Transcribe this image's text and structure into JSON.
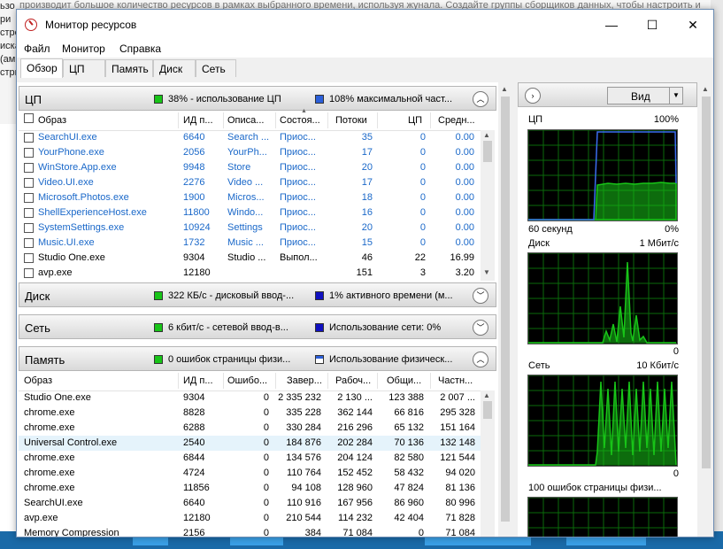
{
  "background": {
    "left_lines": [
      "ьзо",
      "ри",
      "строй",
      "иска",
      "(ам",
      "стри"
    ],
    "top_text": "производит большое количество ресурсов в рамках выбранного времени, используя жунала. Создайте группы сборщиков данных, чтобы настроить и запланировать"
  },
  "window": {
    "title": "Монитор ресурсов",
    "controls": {
      "minimize": "—",
      "maximize": "☐",
      "close": "✕"
    }
  },
  "menu": [
    "Файл",
    "Монитор",
    "Справка"
  ],
  "tabs": [
    "Обзор",
    "ЦП",
    "Память",
    "Диск",
    "Сеть"
  ],
  "cpu": {
    "title": "ЦП",
    "usage_text": "38% - использование ЦП",
    "max_text": "108% максимальной част...",
    "columns": [
      "Образ",
      "ИД п...",
      "Описа...",
      "Состоя...",
      "Потоки",
      "ЦП",
      "Средн..."
    ],
    "rows": [
      {
        "image": "SearchUI.exe",
        "pid": "6640",
        "desc": "Search ...",
        "status": "Приос...",
        "threads": "35",
        "cpu": "0",
        "avg": "0.00",
        "suspended": true
      },
      {
        "image": "YourPhone.exe",
        "pid": "2056",
        "desc": "YourPh...",
        "status": "Приос...",
        "threads": "17",
        "cpu": "0",
        "avg": "0.00",
        "suspended": true
      },
      {
        "image": "WinStore.App.exe",
        "pid": "9948",
        "desc": "Store",
        "status": "Приос...",
        "threads": "20",
        "cpu": "0",
        "avg": "0.00",
        "suspended": true
      },
      {
        "image": "Video.UI.exe",
        "pid": "2276",
        "desc": "Video ...",
        "status": "Приос...",
        "threads": "17",
        "cpu": "0",
        "avg": "0.00",
        "suspended": true
      },
      {
        "image": "Microsoft.Photos.exe",
        "pid": "1900",
        "desc": "Micros...",
        "status": "Приос...",
        "threads": "18",
        "cpu": "0",
        "avg": "0.00",
        "suspended": true
      },
      {
        "image": "ShellExperienceHost.exe",
        "pid": "11800",
        "desc": "Windo...",
        "status": "Приос...",
        "threads": "16",
        "cpu": "0",
        "avg": "0.00",
        "suspended": true
      },
      {
        "image": "SystemSettings.exe",
        "pid": "10924",
        "desc": "Settings",
        "status": "Приос...",
        "threads": "20",
        "cpu": "0",
        "avg": "0.00",
        "suspended": true
      },
      {
        "image": "Music.UI.exe",
        "pid": "1732",
        "desc": "Music ...",
        "status": "Приос...",
        "threads": "15",
        "cpu": "0",
        "avg": "0.00",
        "suspended": true
      },
      {
        "image": "Studio One.exe",
        "pid": "9304",
        "desc": "Studio ...",
        "status": "Выпол...",
        "threads": "46",
        "cpu": "22",
        "avg": "16.99",
        "suspended": false
      },
      {
        "image": "avp.exe",
        "pid": "12180",
        "desc": "",
        "status": "",
        "threads": "151",
        "cpu": "3",
        "avg": "3.20",
        "suspended": false
      }
    ]
  },
  "disk": {
    "title": "Диск",
    "io_text": "322 КБ/с - дисковый ввод-...",
    "active_text": "1% активного времени (м..."
  },
  "network": {
    "title": "Сеть",
    "io_text": "6 кбит/с - сетевой ввод-в...",
    "usage_text": "Использование сети: 0%"
  },
  "memory": {
    "title": "Память",
    "faults_text": "0 ошибок страницы физи...",
    "usage_text": "Использование физическ...",
    "columns": [
      "Образ",
      "ИД п...",
      "Ошибо...",
      "Завер...",
      "Рабоч...",
      "Общи...",
      "Частн..."
    ],
    "rows": [
      {
        "image": "Studio One.exe",
        "pid": "9304",
        "faults": "0",
        "commit": "2 335 232",
        "working": "2 130 ...",
        "shared": "123 388",
        "private": "2 007 ..."
      },
      {
        "image": "chrome.exe",
        "pid": "8828",
        "faults": "0",
        "commit": "335 228",
        "working": "362 144",
        "shared": "66 816",
        "private": "295 328"
      },
      {
        "image": "chrome.exe",
        "pid": "6288",
        "faults": "0",
        "commit": "330 284",
        "working": "216 296",
        "shared": "65 132",
        "private": "151 164"
      },
      {
        "image": "Universal Control.exe",
        "pid": "2540",
        "faults": "0",
        "commit": "184 876",
        "working": "202 284",
        "shared": "70 136",
        "private": "132 148"
      },
      {
        "image": "chrome.exe",
        "pid": "6844",
        "faults": "0",
        "commit": "134 576",
        "working": "204 124",
        "shared": "82 580",
        "private": "121 544"
      },
      {
        "image": "chrome.exe",
        "pid": "4724",
        "faults": "0",
        "commit": "110 764",
        "working": "152 452",
        "shared": "58 432",
        "private": "94 020"
      },
      {
        "image": "chrome.exe",
        "pid": "11856",
        "faults": "0",
        "commit": "94 108",
        "working": "128 960",
        "shared": "47 824",
        "private": "81 136"
      },
      {
        "image": "SearchUI.exe",
        "pid": "6640",
        "faults": "0",
        "commit": "110 916",
        "working": "167 956",
        "shared": "86 960",
        "private": "80 996"
      },
      {
        "image": "avp.exe",
        "pid": "12180",
        "faults": "0",
        "commit": "210 544",
        "working": "114 232",
        "shared": "42 404",
        "private": "71 828"
      },
      {
        "image": "Memory Compression",
        "pid": "2156",
        "faults": "0",
        "commit": "384",
        "working": "71 084",
        "shared": "0",
        "private": "71 084"
      }
    ]
  },
  "right_panel": {
    "view_label": "Вид",
    "graphs": [
      {
        "name": "ЦП",
        "max": "100%",
        "left_footer": "60 секунд",
        "right_footer": "0%"
      },
      {
        "name": "Диск",
        "max": "1 Мбит/с",
        "left_footer": "",
        "right_footer": "0"
      },
      {
        "name": "Сеть",
        "max": "10 Кбит/с",
        "left_footer": "",
        "right_footer": "0"
      },
      {
        "name": "100 ошибок страницы физи...",
        "max": "",
        "left_footer": "",
        "right_footer": ""
      }
    ]
  },
  "colors": {
    "link_blue": "#1a68c9",
    "graph_green": "#18c418",
    "graph_bg": "#000000",
    "graph_grid": "#0a6a0a",
    "max_line": "#3b6cf0"
  }
}
